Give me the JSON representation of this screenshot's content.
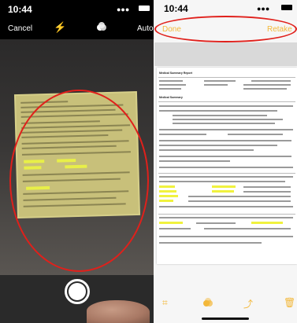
{
  "camera": {
    "time": "10:44",
    "cancel_label": "Cancel",
    "flash_icon": "flash-icon",
    "filter_icon": "filter-icon",
    "auto_label": "Auto",
    "shutter_icon": "shutter-icon",
    "annotation_color": "#e0201b"
  },
  "scan": {
    "time": "10:44",
    "done_label": "Done",
    "retake_label": "Retake",
    "accent_color": "#f3b83a",
    "toolbar_icons": [
      "crop-icon",
      "filter-icon",
      "rotate-icon",
      "trash-icon"
    ],
    "document": {
      "title": "Medical Summary Report",
      "section": "Medical Summary"
    }
  }
}
